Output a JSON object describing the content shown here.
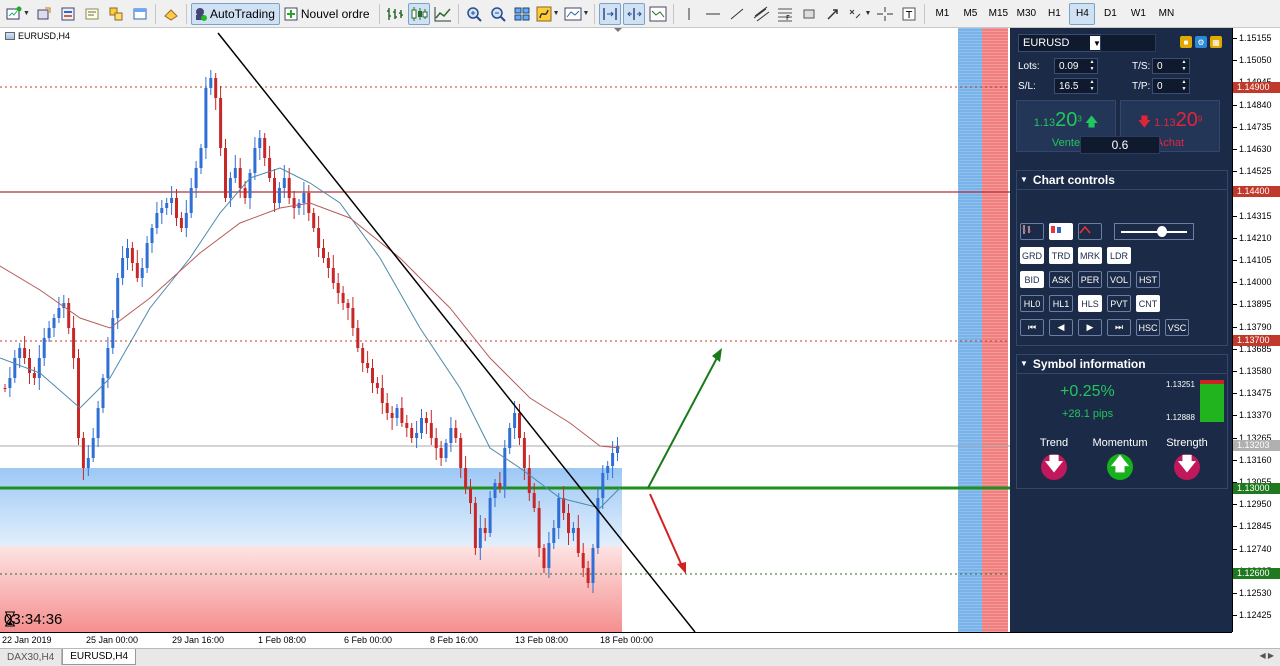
{
  "toolbar": {
    "autotrading_label": "AutoTrading",
    "new_order_label": "Nouvel ordre",
    "timeframes": [
      "M1",
      "M5",
      "M15",
      "M30",
      "H1",
      "H4",
      "D1",
      "W1",
      "MN"
    ],
    "active_timeframe": "H4"
  },
  "chart": {
    "title": "EURUSD,H4",
    "timer": "03:34:36"
  },
  "price_axis": {
    "labels": [
      "1.15155",
      "1.15050",
      "1.14945",
      "1.14840",
      "1.14735",
      "1.14630",
      "1.14525",
      "1.14415",
      "1.14315",
      "1.14210",
      "1.14105",
      "1.14000",
      "1.13895",
      "1.13790",
      "1.13685",
      "1.13580",
      "1.13475",
      "1.13370",
      "1.13265",
      "1.13160",
      "1.13055",
      "1.12950",
      "1.12845",
      "1.12740",
      "1.12635",
      "1.12530",
      "1.12425"
    ],
    "tags": [
      {
        "text": "1.14900",
        "color": "#c0392b"
      },
      {
        "text": "1.14400",
        "color": "#c0392b"
      },
      {
        "text": "1.13700",
        "color": "#c0392b"
      },
      {
        "text": "1.13203",
        "color": "#b0b0b0"
      },
      {
        "text": "1.13000",
        "color": "#1f7a1f"
      },
      {
        "text": "1.12600",
        "color": "#1f7a1f"
      }
    ]
  },
  "time_axis": {
    "labels": [
      "22 Jan 2019",
      "25 Jan 00:00",
      "29 Jan 16:00",
      "1 Feb 08:00",
      "6 Feb 00:00",
      "8 Feb 16:00",
      "13 Feb 08:00",
      "18 Feb 00:00"
    ]
  },
  "panel": {
    "symbol": "EURUSD",
    "lots_label": "Lots:",
    "lots_value": "0.09",
    "ts_label": "T/S:",
    "ts_value": "0",
    "sl_label": "S/L:",
    "sl_value": "16.5",
    "tp_label": "T/P:",
    "tp_value": "0",
    "sell": {
      "prefix": "1.13",
      "big": "20",
      "sup": "3",
      "label": "Vente"
    },
    "buy": {
      "prefix": "1.13",
      "big": "20",
      "sup": "9",
      "label": "Achat"
    },
    "spread": "0.6",
    "chart_controls_title": "Chart controls",
    "row1": [
      "GRD",
      "TRD",
      "MRK",
      "LDR"
    ],
    "row2": [
      "BID",
      "ASK",
      "PER",
      "VOL",
      "HST"
    ],
    "row3": [
      "HL0",
      "HL1",
      "HLS",
      "PVT",
      "CNT"
    ],
    "row4": [
      "⏮",
      "◀",
      "▶",
      "⏭",
      "HSC",
      "VSC"
    ],
    "symbol_info_title": "Symbol information",
    "change_pct": "+0.25%",
    "change_pips": "+28.1 pips",
    "range_high": "1.13251",
    "range_low": "1.12888",
    "trend_label": "Trend",
    "momentum_label": "Momentum",
    "strength_label": "Strength"
  },
  "tabs": [
    "DAX30,H4",
    "EURUSD,H4"
  ],
  "colors": {
    "panel_bg": "#1b2a47",
    "bull": "#2f6fd6",
    "bear": "#c62828",
    "support": "#1f9d1f"
  }
}
